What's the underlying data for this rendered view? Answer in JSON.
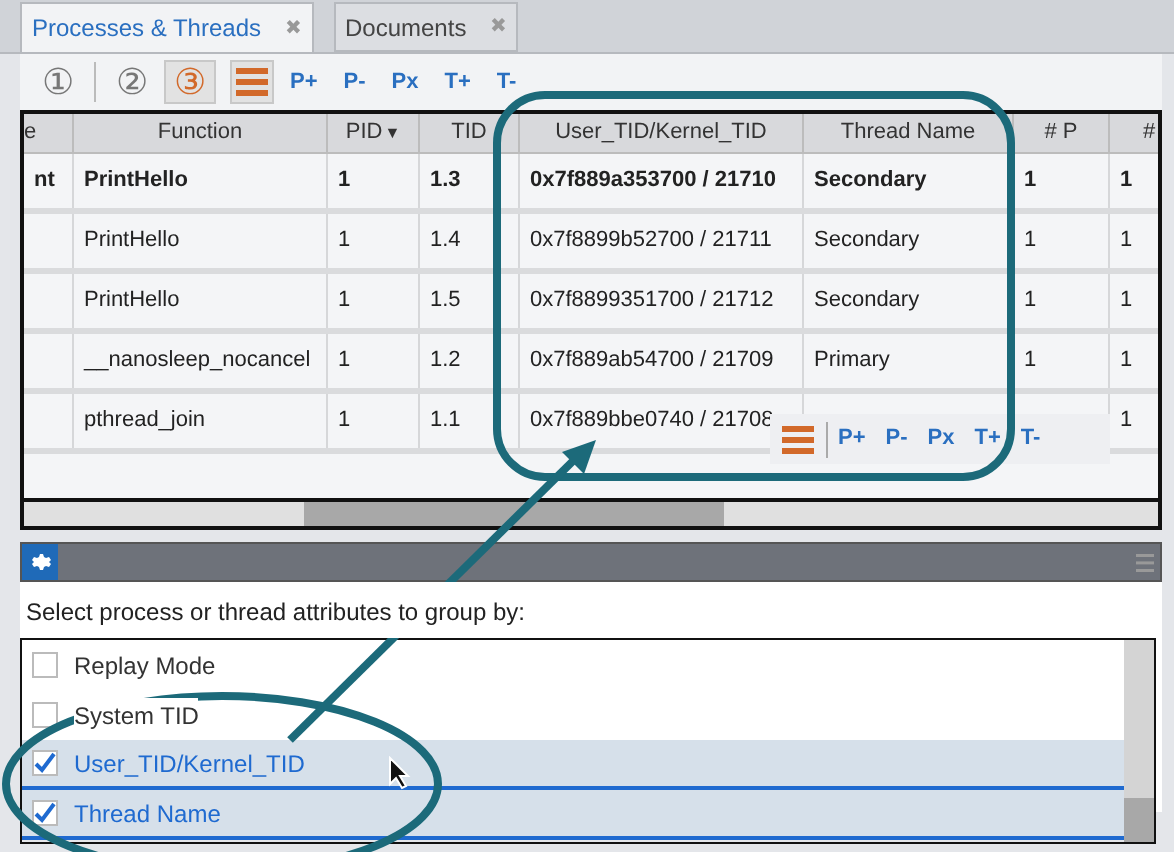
{
  "tabs": [
    {
      "label": "Processes & Threads",
      "close": "✖",
      "selected": true
    },
    {
      "label": "Documents",
      "close": "✖",
      "selected": false
    }
  ],
  "toolbar": {
    "levels": [
      {
        "label": "①",
        "selected": false
      },
      {
        "label": "②",
        "selected": false
      },
      {
        "label": "③",
        "selected": true
      }
    ],
    "actions": [
      "P+",
      "P-",
      "Px",
      "T+",
      "T-"
    ]
  },
  "table": {
    "columns": [
      {
        "label": "e"
      },
      {
        "label": "Function"
      },
      {
        "label": "PID",
        "sort_icon": "▼"
      },
      {
        "label": "TID"
      },
      {
        "label": "User_TID/Kernel_TID"
      },
      {
        "label": "Thread Name"
      },
      {
        "label": "# P"
      },
      {
        "label": "#"
      }
    ],
    "rows": [
      {
        "bold": true,
        "cells": [
          "nt",
          "PrintHello",
          "1",
          "1.3",
          "0x7f889a353700 / 21710",
          "Secondary",
          "1",
          "1"
        ]
      },
      {
        "bold": false,
        "cells": [
          "",
          "PrintHello",
          "1",
          "1.4",
          "0x7f8899b52700 / 21711",
          "Secondary",
          "1",
          "1"
        ]
      },
      {
        "bold": false,
        "cells": [
          "",
          "PrintHello",
          "1",
          "1.5",
          "0x7f8899351700 / 21712",
          "Secondary",
          "1",
          "1"
        ]
      },
      {
        "bold": false,
        "cells": [
          "",
          "__nanosleep_nocancel",
          "1",
          "1.2",
          "0x7f889ab54700 / 21709",
          "Primary",
          "1",
          "1"
        ]
      },
      {
        "bold": false,
        "cells": [
          "",
          "pthread_join",
          "1",
          "1.1",
          "0x7f889bbe0740 / 21708",
          "",
          "",
          "1"
        ]
      }
    ]
  },
  "floating_toolbar": {
    "actions": [
      "P+",
      "P-",
      "Px",
      "T+",
      "T-"
    ]
  },
  "group_panel": {
    "prompt": "Select process or thread attributes to group by:",
    "items": [
      {
        "label": "Replay Mode",
        "checked": false,
        "selected": false
      },
      {
        "label": "System TID",
        "checked": false,
        "selected": false
      },
      {
        "label": "User_TID/Kernel_TID",
        "checked": true,
        "selected": true
      },
      {
        "label": "Thread Name",
        "checked": true,
        "selected": true
      }
    ]
  }
}
